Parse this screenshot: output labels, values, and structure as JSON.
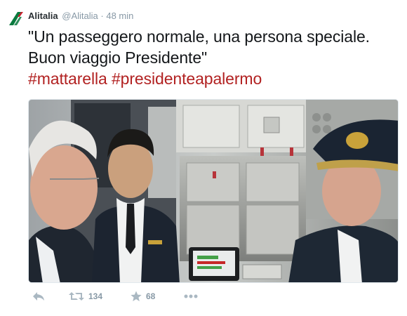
{
  "tweet": {
    "author_name": "Alitalia",
    "handle": "@Alitalia",
    "separator": "·",
    "time": "48 min",
    "text": "\"Un passeggero normale, una persona speciale. Buon viaggio Presidente\"",
    "hashtags": [
      "#mattarella",
      "#presidenteapalermo"
    ]
  },
  "actions": {
    "reply_icon": "reply-icon",
    "retweet_icon": "retweet-icon",
    "retweet_count": "134",
    "favorite_icon": "star-icon",
    "favorite_count": "68",
    "more_icon": "more-icon"
  },
  "colors": {
    "brand_green": "#0a7a3e",
    "brand_red": "#c8202f",
    "hashtag": "#b22222",
    "muted": "#8899a6"
  }
}
